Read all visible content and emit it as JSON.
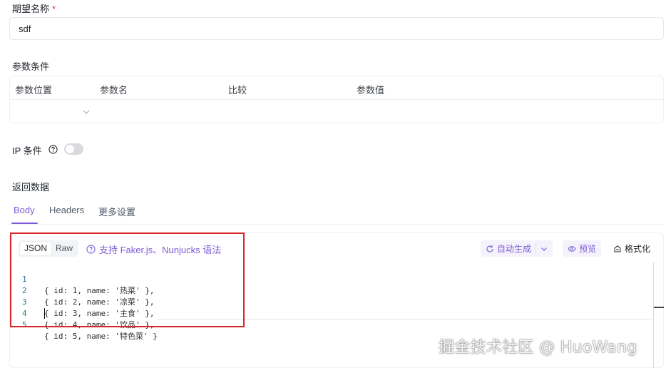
{
  "form": {
    "name_label": "期望名称",
    "required_mark": "*",
    "name_value": "sdf"
  },
  "params": {
    "section_label": "参数条件",
    "columns": [
      "参数位置",
      "参数名",
      "比较",
      "参数值"
    ]
  },
  "ip": {
    "label": "IP 条件",
    "enabled": false
  },
  "response": {
    "section_label": "返回数据",
    "tabs": [
      "Body",
      "Headers",
      "更多设置"
    ],
    "active_tab": "Body"
  },
  "editor": {
    "modes": [
      "JSON",
      "Raw"
    ],
    "active_mode": "JSON",
    "faker_hint": "支持 Faker.js、Nunjucks 语法",
    "auto_generate": "自动生成",
    "preview": "预览",
    "format": "格式化",
    "lines": [
      {
        "num": "1",
        "text": "{ id: 1, name: '热菜' },"
      },
      {
        "num": "2",
        "text": "{ id: 2, name: '凉菜' },"
      },
      {
        "num": "3",
        "text": "{ id: 3, name: '主食' },"
      },
      {
        "num": "4",
        "text": "{ id: 4, name: '饮品' },"
      },
      {
        "num": "5",
        "text": "{ id: 5, name: '特色菜' }"
      }
    ]
  },
  "watermark": "掘金技术社区 @ HuoWang",
  "colors": {
    "accent": "#7c5cd6",
    "required": "#e53935",
    "highlight": "#d9262c"
  },
  "icons": [
    "help-circle-icon",
    "chevron-down-icon",
    "refresh-icon",
    "eye-icon",
    "format-icon"
  ]
}
